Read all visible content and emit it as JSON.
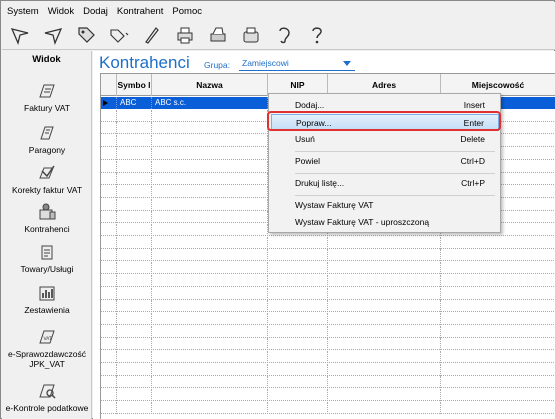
{
  "menubar": [
    "System",
    "Widok",
    "Dodaj",
    "Kontrahent",
    "Pomoc"
  ],
  "toolbar": {
    "icons": [
      "arrow-left-icon",
      "arrow-right-icon",
      "tag-icon",
      "tags-icon",
      "pen-icon",
      "printer-icon",
      "printer-settings-icon",
      "fax-icon",
      "ear-icon",
      "help-icon"
    ]
  },
  "sidebar": {
    "header": "Widok",
    "items": [
      {
        "label": "Faktury VAT",
        "icon": "invoice-icon"
      },
      {
        "label": "Paragony",
        "icon": "receipt-icon"
      },
      {
        "label": "Korekty faktur VAT",
        "icon": "correction-icon"
      },
      {
        "label": "Kontrahenci",
        "icon": "contractors-icon"
      },
      {
        "label": "Towary/Usługi",
        "icon": "goods-icon"
      },
      {
        "label": "Zestawienia",
        "icon": "reports-icon"
      },
      {
        "label": "e-Sprawozdawczość JPK_VAT",
        "icon": "jpk-icon"
      },
      {
        "label": "e-Kontrole podatkowe",
        "icon": "tax-control-icon"
      }
    ]
  },
  "main": {
    "title": "Kontrahenci",
    "grupa_label": "Grupa:",
    "grupa_value": "Zamiejscowi"
  },
  "table": {
    "columns": [
      "Symbo l",
      "Nazwa",
      "NIP",
      "Adres",
      "Miejscowość"
    ],
    "rows": [
      {
        "symbol": "ABC",
        "nazwa": "ABC s.c.",
        "nip": "",
        "adres": "",
        "miejscowosc": ""
      }
    ]
  },
  "context_menu": {
    "items": [
      {
        "label": "Dodaj...",
        "shortcut": "Insert"
      },
      {
        "label": "Popraw...",
        "shortcut": "Enter"
      },
      {
        "label": "Usuń",
        "shortcut": "Delete"
      },
      {
        "label": "Powiel",
        "shortcut": "Ctrl+D"
      },
      {
        "label": "Drukuj listę...",
        "shortcut": "Ctrl+P"
      },
      {
        "label": "Wystaw Fakturę VAT",
        "shortcut": ""
      },
      {
        "label": "Wystaw Fakturę VAT - uproszczoną",
        "shortcut": ""
      }
    ],
    "highlighted_index": 1
  },
  "colors": {
    "accent": "#1e6fc8",
    "selection": "#0a5fd8",
    "highlight_ring": "#e03030"
  }
}
